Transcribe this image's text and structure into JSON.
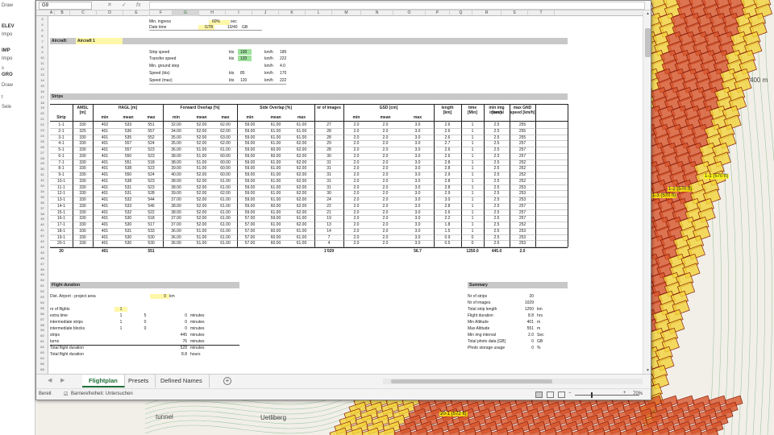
{
  "map": {
    "labels": [
      "400 m",
      "tunnel",
      "Uetliberg"
    ],
    "overlay_labels": [
      "1-1 (570 ft)",
      "1-2 (570 ft)",
      "1-3 (570 ft)",
      "20-1 (572 ft)"
    ],
    "colors": {
      "fill_red": "#d8552a",
      "fill_yellow": "#f2d33a",
      "edge": "#8a1d0c"
    }
  },
  "left_panel": {
    "items": [
      "Draw",
      "ELEV",
      "Impo",
      "IMP",
      "Impo",
      "s",
      "GRO",
      "Draw",
      "t",
      "Sele"
    ]
  },
  "formula_bar": {
    "name_box": "G9",
    "cancel": "✕",
    "enter": "✓",
    "fx": "fx",
    "content": ""
  },
  "columns": [
    "A",
    "B",
    "C",
    "D",
    "E",
    "F",
    "G",
    "H",
    "I",
    "J",
    "K",
    "L",
    "M",
    "N",
    "O",
    "P",
    "Q",
    "R",
    "S",
    "T"
  ],
  "rows": [
    "3",
    "4",
    "5",
    "6",
    "7",
    "8",
    "9",
    "10",
    "11",
    "12",
    "13",
    "14",
    "15",
    "16",
    "17",
    "18",
    "19",
    "20",
    "21",
    "22",
    "23",
    "24",
    "25",
    "26",
    "27",
    "28",
    "29",
    "30",
    "31",
    "32",
    "33",
    "34",
    "35",
    "36",
    "37",
    "38",
    "39",
    "40",
    "41",
    "42",
    "43",
    "44",
    "45",
    "46",
    "47",
    "48",
    "49",
    "50",
    "51",
    "52",
    "53",
    "54",
    "55",
    "56",
    "57",
    "58",
    "59",
    "60",
    "61",
    "62",
    "63",
    "64",
    "65",
    "66"
  ],
  "sheet": {
    "top": {
      "min_ingress_label": "Min. ingress",
      "min_ingress_value": "60%",
      "min_ingress_unit": "sec",
      "date_label": "Date time",
      "date_a": "GTB",
      "date_b": "10/40",
      "date_c": "GB"
    },
    "aircraft": {
      "label": "Aircraft:",
      "value": "Aircraft 1"
    },
    "params": [
      {
        "label": "Strip speed",
        "a": "kts",
        "b": "100",
        "c": "km/h",
        "d": "185"
      },
      {
        "label": "Transfer speed",
        "a": "kts",
        "b": "120",
        "c": "km/h",
        "d": "222"
      },
      {
        "label": "Min. ground step",
        "a": "",
        "b": "",
        "c": "km/h",
        "d": "4.0"
      },
      {
        "label": "Speed (kts)",
        "a": "kts",
        "b": "85",
        "c": "km/h",
        "d": "170"
      },
      {
        "label": "Speed (max)",
        "a": "kts",
        "b": "120",
        "c": "km/h",
        "d": "222"
      }
    ],
    "strips_title": "Strips",
    "group_headers": [
      "AMSL",
      "HAGL [m]",
      "Forward Overlap [%]",
      "Side Overlap [%]",
      "nr of images",
      "GSD [cm]",
      "length",
      "time",
      "min img interval",
      "max GND speed [km/h]"
    ],
    "group_units": [
      "[m]",
      "",
      "",
      "",
      "",
      "",
      "[km]",
      "[Min]",
      "[sec]",
      ""
    ],
    "sub_headers": [
      "Strip",
      "",
      "min",
      "mean",
      "max",
      "min",
      "mean",
      "max",
      "min",
      "mean",
      "max",
      "",
      "min",
      "mean",
      "max",
      "",
      "",
      "",
      ""
    ],
    "strips": [
      [
        "1-1",
        "330",
        "402",
        "533",
        "551",
        "32.00",
        "52.00",
        "62.00",
        "59.00",
        "61.00",
        "61.00",
        "27",
        "2.0",
        "2.0",
        "3.0",
        "2.6",
        "1",
        "2.5",
        "255"
      ],
      [
        "2-1",
        "325",
        "401",
        "536",
        "557",
        "34.00",
        "52.00",
        "62.00",
        "59.00",
        "61.00",
        "61.00",
        "28",
        "2.0",
        "2.0",
        "3.0",
        "2.6",
        "1",
        "2.5",
        "255"
      ],
      [
        "3-1",
        "330",
        "401",
        "535",
        "552",
        "35.00",
        "52.00",
        "63.00",
        "59.00",
        "61.00",
        "61.00",
        "28",
        "2.0",
        "2.0",
        "3.0",
        "2.6",
        "1",
        "2.5",
        "255"
      ],
      [
        "4-1",
        "330",
        "401",
        "557",
        "524",
        "35.00",
        "52.00",
        "62.00",
        "59.00",
        "61.00",
        "62.00",
        "29",
        "2.0",
        "2.0",
        "3.0",
        "2.7",
        "1",
        "2.5",
        "257"
      ],
      [
        "5-1",
        "330",
        "401",
        "557",
        "523",
        "36.00",
        "51.00",
        "61.00",
        "59.00",
        "60.00",
        "62.00",
        "28",
        "2.0",
        "2.0",
        "3.0",
        "2.6",
        "1",
        "2.5",
        "257"
      ],
      [
        "6-1",
        "330",
        "401",
        "550",
        "523",
        "38.00",
        "51.00",
        "60.00",
        "59.00",
        "60.00",
        "62.00",
        "30",
        "2.0",
        "2.0",
        "3.0",
        "2.6",
        "1",
        "2.5",
        "257"
      ],
      [
        "7-1",
        "330",
        "401",
        "551",
        "518",
        "38.00",
        "51.00",
        "60.00",
        "59.00",
        "61.00",
        "62.00",
        "31",
        "2.0",
        "2.0",
        "3.0",
        "2.8",
        "1",
        "2.5",
        "252"
      ],
      [
        "8-1",
        "330",
        "401",
        "538",
        "523",
        "39.00",
        "51.00",
        "60.00",
        "59.00",
        "61.00",
        "62.00",
        "31",
        "2.0",
        "2.0",
        "3.0",
        "2.8",
        "1",
        "2.5",
        "252"
      ],
      [
        "9-1",
        "330",
        "401",
        "550",
        "524",
        "40.00",
        "52.00",
        "60.00",
        "59.00",
        "61.00",
        "62.00",
        "31",
        "2.0",
        "2.0",
        "3.0",
        "2.9",
        "1",
        "2.5",
        "252"
      ],
      [
        "10-1",
        "330",
        "401",
        "538",
        "523",
        "38.00",
        "52.00",
        "61.00",
        "59.00",
        "61.00",
        "62.00",
        "31",
        "2.0",
        "2.0",
        "3.0",
        "2.8",
        "1",
        "2.5",
        "252"
      ],
      [
        "11-1",
        "330",
        "401",
        "531",
        "523",
        "38.00",
        "52.00",
        "61.00",
        "59.00",
        "61.00",
        "62.00",
        "31",
        "2.0",
        "2.0",
        "3.0",
        "2.8",
        "1",
        "2.5",
        "253"
      ],
      [
        "12-1",
        "330",
        "401",
        "531",
        "528",
        "39.00",
        "52.00",
        "62.00",
        "59.00",
        "61.00",
        "62.00",
        "30",
        "2.0",
        "2.0",
        "3.0",
        "2.9",
        "1",
        "2.5",
        "253"
      ],
      [
        "13-1",
        "330",
        "401",
        "532",
        "544",
        "37.00",
        "52.00",
        "61.00",
        "59.00",
        "61.00",
        "62.00",
        "24",
        "2.0",
        "2.0",
        "3.0",
        "3.0",
        "1",
        "2.5",
        "253"
      ],
      [
        "14-1",
        "330",
        "401",
        "533",
        "546",
        "38.00",
        "52.00",
        "61.00",
        "59.00",
        "60.00",
        "62.00",
        "22",
        "2.0",
        "2.0",
        "3.0",
        "2.8",
        "1",
        "2.5",
        "257"
      ],
      [
        "15-1",
        "330",
        "401",
        "532",
        "522",
        "38.00",
        "52.00",
        "61.00",
        "59.00",
        "61.00",
        "62.00",
        "21",
        "2.0",
        "2.0",
        "3.0",
        "2.6",
        "1",
        "2.5",
        "257"
      ],
      [
        "16-1",
        "330",
        "401",
        "530",
        "518",
        "37.00",
        "52.00",
        "61.00",
        "57.00",
        "59.00",
        "61.00",
        "19",
        "2.0",
        "2.0",
        "3.0",
        "2.2",
        "1",
        "2.5",
        "257"
      ],
      [
        "17-1",
        "330",
        "401",
        "530",
        "517",
        "37.00",
        "52.00",
        "61.00",
        "57.00",
        "61.00",
        "62.00",
        "13",
        "2.0",
        "2.0",
        "3.0",
        "1.8",
        "1",
        "2.5",
        "252"
      ],
      [
        "18-1",
        "330",
        "401",
        "531",
        "533",
        "36.00",
        "51.00",
        "61.00",
        "57.00",
        "60.00",
        "61.00",
        "14",
        "2.0",
        "2.0",
        "3.0",
        "1.5",
        "1",
        "2.5",
        "253"
      ],
      [
        "19-1",
        "330",
        "401",
        "530",
        "530",
        "36.00",
        "51.00",
        "61.00",
        "57.00",
        "60.00",
        "61.00",
        "7",
        "2.0",
        "2.0",
        "3.0",
        "0.9",
        "0",
        "2.5",
        "253"
      ],
      [
        "20-1",
        "330",
        "401",
        "530",
        "530",
        "36.00",
        "51.00",
        "61.00",
        "57.00",
        "60.00",
        "61.00",
        "4",
        "2.0",
        "2.0",
        "3.0",
        "0.5",
        "0",
        "2.5",
        "253"
      ]
    ],
    "totals": {
      "strips": "20",
      "hagl": "401",
      "hagl_max": "551",
      "images": "1'029",
      "gsd": "56.7",
      "length": "1250.0",
      "time": "445.0",
      "interval": "2.0"
    },
    "flight_duration": {
      "title": "Flight duration",
      "dist_label": "Dist. Airport - project area",
      "dist_value": "0",
      "dist_unit": "km",
      "nr_flights_label": "nr of flights",
      "nr_flights_value": "1",
      "rows": [
        {
          "label": "extra time",
          "a": "1",
          "b": "5",
          "c": "0",
          "unit": "minutes"
        },
        {
          "label": "intermediate strips",
          "a": "1",
          "b": "0",
          "c": "0",
          "unit": "minutes"
        },
        {
          "label": "intermediate blocks",
          "a": "1",
          "b": "0",
          "c": "0",
          "unit": "minutes"
        },
        {
          "label": "strips",
          "a": "",
          "b": "",
          "c": "445",
          "unit": "minutes"
        },
        {
          "label": "turns",
          "a": "",
          "b": "",
          "c": "76",
          "unit": "minutes"
        },
        {
          "label": "Total flight duration",
          "a": "",
          "b": "",
          "c": "528",
          "unit": "minutes"
        },
        {
          "label": "Total flight duration",
          "a": "",
          "b": "",
          "c": "8.8",
          "unit": "hours"
        }
      ]
    },
    "summary": {
      "title": "Summary",
      "rows": [
        {
          "label": "Nr of strips",
          "value": "20",
          "unit": ""
        },
        {
          "label": "Nr of images",
          "value": "1029",
          "unit": ""
        },
        {
          "label": "Total strip length",
          "value": "1250",
          "unit": "km"
        },
        {
          "label": "Flight duration",
          "value": "8.8",
          "unit": "hrs"
        },
        {
          "label": "Min Altitude",
          "value": "401",
          "unit": "m"
        },
        {
          "label": "Max Altitude",
          "value": "551",
          "unit": "m"
        },
        {
          "label": "Min img interval",
          "value": "2.0",
          "unit": "Sec"
        },
        {
          "label": "Total photo data [GB]",
          "value": "0",
          "unit": "GB"
        },
        {
          "label": "Photo storage usage",
          "value": "0",
          "unit": "%"
        }
      ]
    }
  },
  "tabs": {
    "nav_prev": "◀",
    "nav_next": "▶",
    "items": [
      "Flightplan",
      "Presets",
      "Defined Names"
    ],
    "active": "Flightplan",
    "add": "+"
  },
  "status_bar": {
    "ready": "Bereit",
    "accessibility": "Barrierefreiheit: Untersuchen",
    "zoom_minus": "−",
    "zoom_plus": "+",
    "zoom": "70%"
  }
}
